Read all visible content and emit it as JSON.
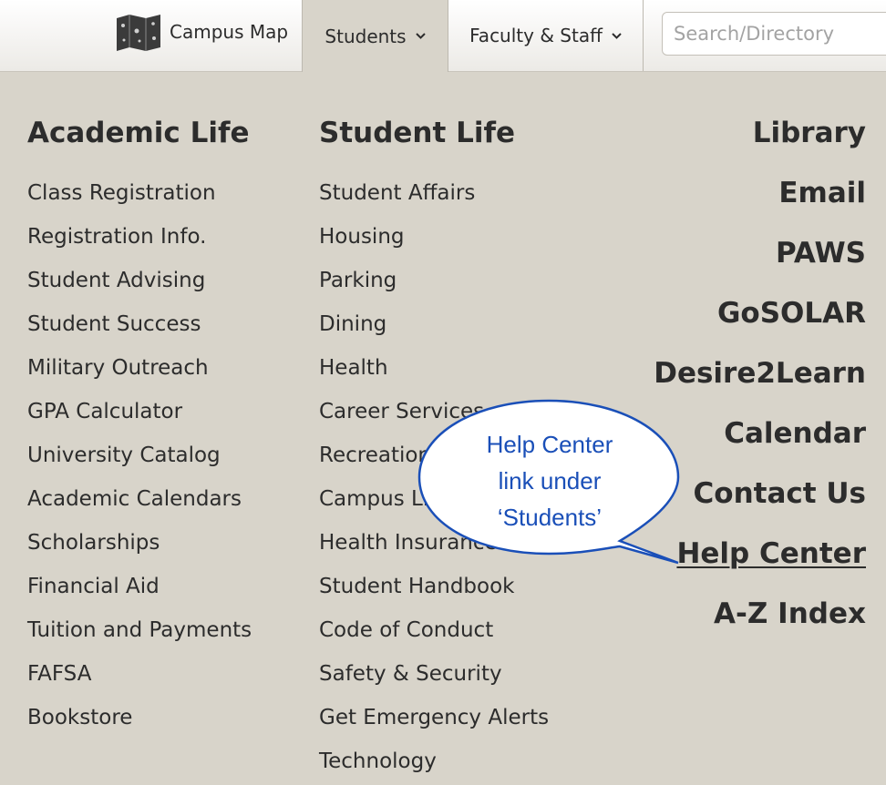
{
  "topbar": {
    "campus_map_label": "Campus Map",
    "tabs": [
      {
        "label": "Students",
        "active": true
      },
      {
        "label": "Faculty & Staff",
        "active": false
      }
    ],
    "search_placeholder": "Search/Directory"
  },
  "academic_life": {
    "heading": "Academic Life",
    "items": [
      "Class Registration",
      "Registration Info.",
      "Student Advising",
      "Student Success",
      "Military Outreach",
      "GPA Calculator",
      "University Catalog",
      "Academic Calendars",
      "Scholarships",
      "Financial Aid",
      "Tuition and Payments",
      "FAFSA",
      "Bookstore"
    ]
  },
  "student_life": {
    "heading": "Student Life",
    "items": [
      "Student Affairs",
      "Housing",
      "Parking",
      "Dining",
      "Health",
      "Career Services",
      "Recreation",
      "Campus Life",
      "Health Insurance",
      "Student Handbook",
      "Code of Conduct",
      "Safety & Security",
      "Get Emergency Alerts",
      "Technology"
    ]
  },
  "quick_links": {
    "items": [
      "Library",
      "Email",
      "PAWS",
      "GoSOLAR",
      "Desire2Learn",
      "Calendar",
      "Contact Us",
      "Help Center",
      "A-Z Index"
    ]
  },
  "callout": {
    "lines": [
      "Help Center",
      "link under",
      "‘Students’"
    ],
    "color": "#1a4fb8"
  },
  "colors": {
    "background": "#d8d4ca",
    "text": "#2c2c2c"
  }
}
